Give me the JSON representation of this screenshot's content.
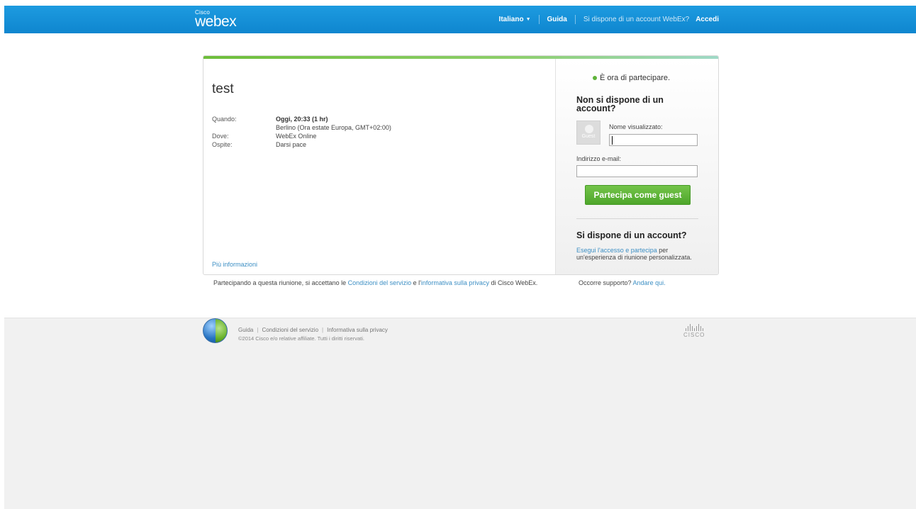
{
  "header": {
    "logo_small": "Cisco",
    "logo_main": "webex",
    "language": "Italiano",
    "help": "Guida",
    "account_question": "Si dispone di un account WebEx?",
    "sign_in": "Accedi"
  },
  "meeting": {
    "title": "test",
    "details": [
      {
        "key": "Quando:",
        "value": "Oggi, 20:33  (1 hr)",
        "bold": true
      },
      {
        "key": "",
        "value": "Berlino (Ora estate Europa, GMT+02:00)",
        "bold": false
      },
      {
        "key": "Dove:",
        "value": "WebEx Online",
        "bold": false
      },
      {
        "key": "Ospite:",
        "value": "Darsi pace",
        "bold": false
      }
    ],
    "more_info": "Più informazioni"
  },
  "join": {
    "status": "È ora di partecipare.",
    "no_account_title": "Non si dispone di un account?",
    "guest_avatar_label": "Guest",
    "display_name_label": "Nome visualizzato:",
    "display_name_value": "",
    "email_label": "Indirizzo e-mail:",
    "email_value": "",
    "join_button": "Partecipa come guest",
    "have_account_title": "Si dispone di un account?",
    "signin_link": "Esegui l'accesso e partecipa",
    "signin_rest": " per un'esperienza di riunione personalizzata."
  },
  "terms": {
    "prefix": "Partecipando a questa riunione, si accettano le ",
    "tos_link": "Condizioni del servizio",
    "middle": " e l'",
    "privacy_link": "informativa sulla privacy",
    "suffix": " di Cisco WebEx."
  },
  "support": {
    "text": "Occorre supporto? ",
    "link": "Andare qui."
  },
  "footer": {
    "links": [
      "Guida",
      "Condizioni del servizio",
      "Informativa sulla privacy"
    ],
    "copyright": "©2014 Cisco e/o relative affiliate. Tutti i diritti riservati.",
    "cisco_word": "CISCO"
  },
  "colors": {
    "topbar": "#1d9be0",
    "accent_green": "#5fb33a",
    "link": "#3d8fc4"
  }
}
